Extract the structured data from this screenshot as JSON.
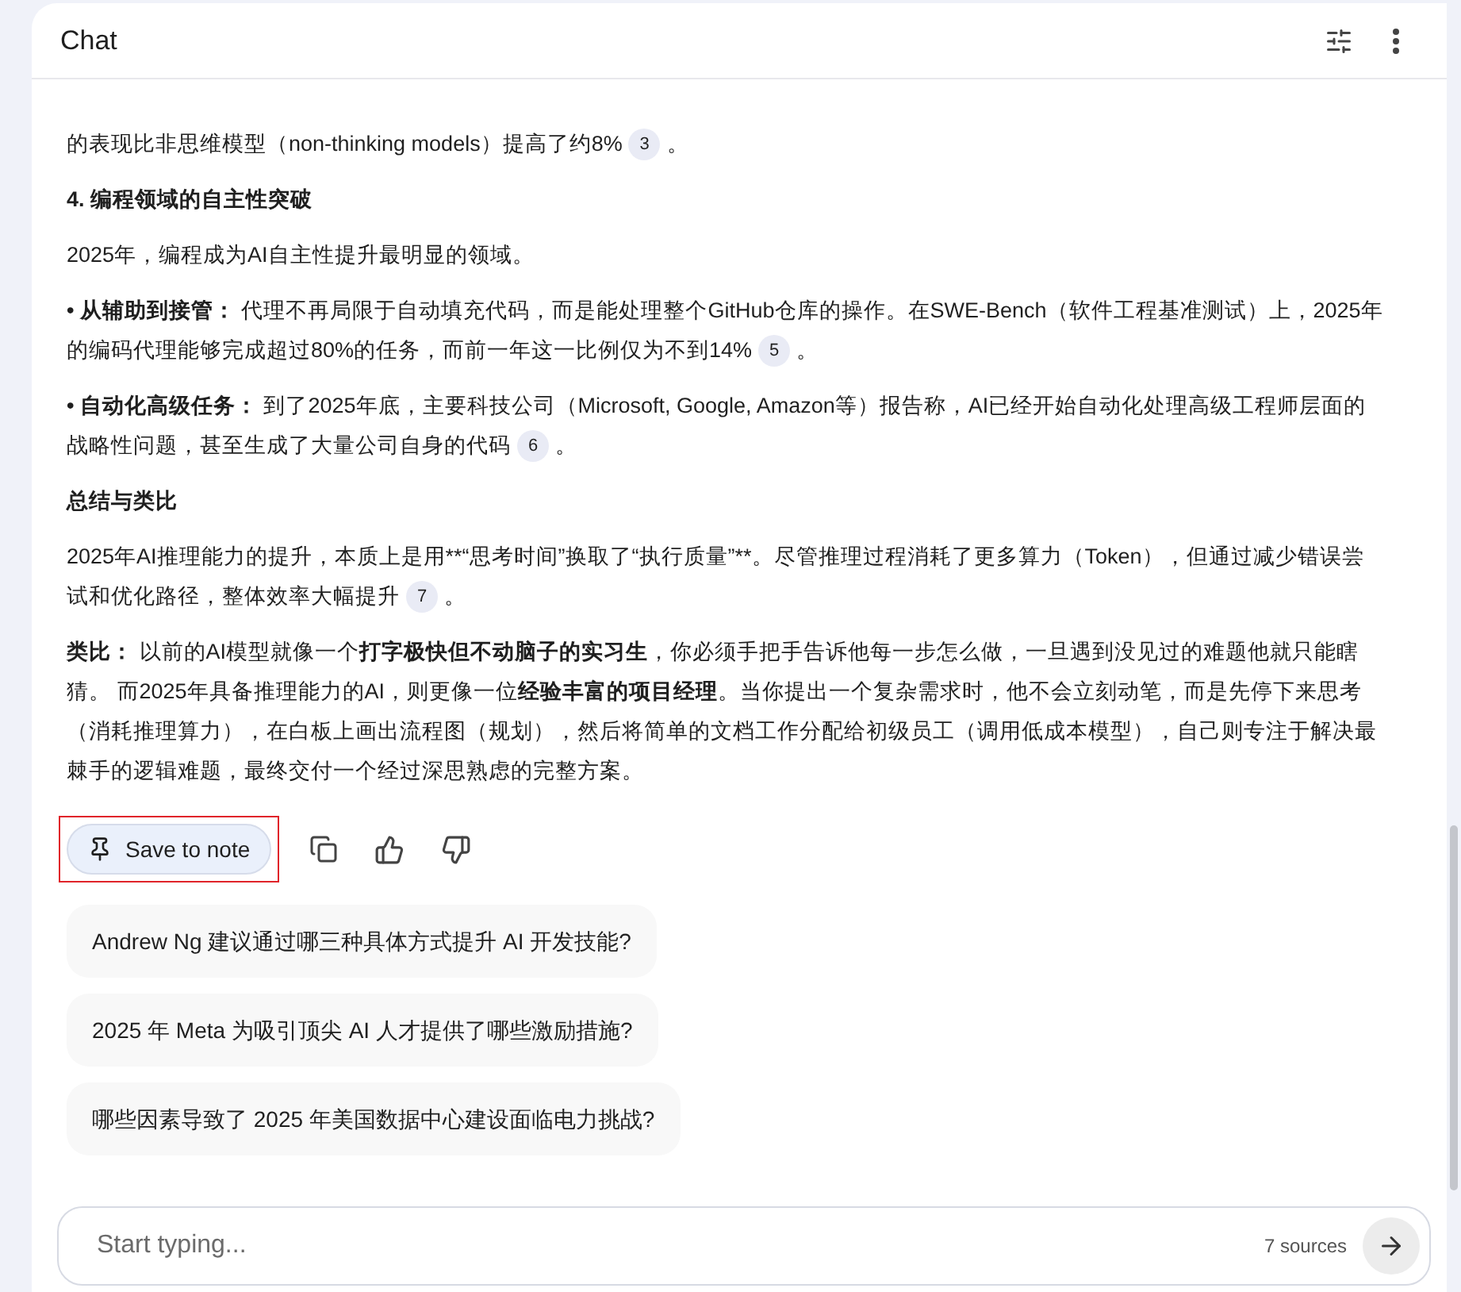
{
  "header": {
    "title": "Chat"
  },
  "blocks": [
    {
      "kind": "para",
      "segments": [
        {
          "text": "的表现比非思维模型（non-thinking models）提高了约8%",
          "bold": false
        }
      ],
      "cite": "3",
      "tail": "。"
    },
    {
      "kind": "heading",
      "segments": [
        {
          "text": "4. 编程领域的自主性突破",
          "bold": true
        }
      ]
    },
    {
      "kind": "para",
      "segments": [
        {
          "text": "2025年，编程成为AI自主性提升最明显的领域。",
          "bold": false
        }
      ]
    },
    {
      "kind": "para",
      "segments": [
        {
          "text": "• 从辅助到接管：",
          "bold": true
        },
        {
          "text": " 代理不再局限于自动填充代码，而是能处理整个GitHub仓库的操作。在SWE-Bench（软件工程基准测试）上，2025年的编码代理能够完成超过80%的任务，而前一年这一比例仅为不到14%",
          "bold": false
        }
      ],
      "cite": "5",
      "tail": "。"
    },
    {
      "kind": "para",
      "segments": [
        {
          "text": "• 自动化高级任务：",
          "bold": true
        },
        {
          "text": " 到了2025年底，主要科技公司（Microsoft, Google, Amazon等）报告称，AI已经开始自动化处理高级工程师层面的战略性问题，甚至生成了大量公司自身的代码",
          "bold": false
        }
      ],
      "cite": "6",
      "tail": "。"
    },
    {
      "kind": "heading",
      "segments": [
        {
          "text": "总结与类比",
          "bold": true
        }
      ]
    },
    {
      "kind": "para",
      "segments": [
        {
          "text": "2025年AI推理能力的提升，本质上是用**“思考时间”换取了“执行质量”**。尽管推理过程消耗了更多算力（Token），但通过减少错误尝试和优化路径，整体效率大幅提升",
          "bold": false
        }
      ],
      "cite": "7",
      "tail": "。"
    },
    {
      "kind": "para",
      "segments": [
        {
          "text": "类比：",
          "bold": true
        },
        {
          "text": " 以前的AI模型就像一个",
          "bold": false
        },
        {
          "text": "打字极快但不动脑子的实习生",
          "bold": true
        },
        {
          "text": "，你必须手把手告诉他每一步怎么做，一旦遇到没见过的难题他就只能瞎猜。 而2025年具备推理能力的AI，则更像一位",
          "bold": false
        },
        {
          "text": "经验丰富的项目经理",
          "bold": true
        },
        {
          "text": "。当你提出一个复杂需求时，他不会立刻动笔，而是先停下来思考（消耗推理算力），在白板上画出流程图（规划），然后将简单的文档工作分配给初级员工（调用低成本模型），自己则专注于解决最棘手的逻辑难题，最终交付一个经过深思熟虑的完整方案。",
          "bold": false
        }
      ]
    }
  ],
  "save_button": {
    "label": "Save to note",
    "highlighted": true
  },
  "suggestions": [
    "Andrew Ng 建议通过哪三种具体方式提升 AI 开发技能?",
    "2025 年 Meta 为吸引顶尖 AI 人才提供了哪些激励措施?",
    "哪些因素导致了 2025 年美国数据中心建设面临电力挑战?"
  ],
  "composer": {
    "placeholder": "Start typing...",
    "sources": "7 sources"
  }
}
